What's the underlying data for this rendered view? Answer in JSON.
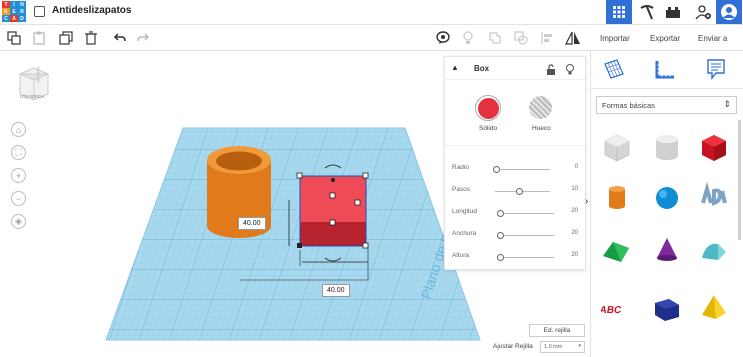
{
  "app": {
    "logo_letters": [
      "T",
      "I",
      "N",
      "K",
      "E",
      "R",
      "C",
      "A",
      "D"
    ],
    "title": "Antideslizapatos"
  },
  "colors": {
    "accent": "#2f6fd6",
    "workplane": "#a7d8ee",
    "box_red": "#e5303d",
    "cylinder_orange": "#e07a1a"
  },
  "header_actions": {
    "grid_view_icon": "grid-icon",
    "tinker_icon": "pickaxe-icon",
    "bricks_icon": "brick-icon",
    "add_user_icon": "add-user-icon",
    "avatar_icon": "avatar"
  },
  "toolbar": {
    "icons": [
      "copy-icon",
      "paste-icon",
      "duplicate-icon",
      "delete-icon",
      "undo-icon",
      "redo-icon"
    ],
    "right_icons": [
      "note-icon",
      "light-icon",
      "group-icon",
      "ungroup-icon",
      "align-icon",
      "mirror-icon"
    ],
    "import_label": "Importar",
    "export_label": "Exportar",
    "send_label": "Enviar a"
  },
  "view_cube": {
    "label": "IZQUIERDA",
    "side_label": "DETRÁS"
  },
  "workplane": {
    "watermark": "Plano de trabajo",
    "dim_height": "40.00",
    "dim_width": "40.00"
  },
  "inspector": {
    "title": "Box",
    "solid_label": "Sólido",
    "hole_label": "Hueco",
    "params": [
      {
        "label": "Radio",
        "value": "0",
        "fraction": 0.0
      },
      {
        "label": "Pasos",
        "value": "10",
        "fraction": 0.45
      },
      {
        "label": "Longitud",
        "value": "20",
        "fraction": 0.0
      },
      {
        "label": "Anchura",
        "value": "20",
        "fraction": 0.0
      },
      {
        "label": "Altura",
        "value": "20",
        "fraction": 0.0
      }
    ]
  },
  "right_panel": {
    "category": "Formas básicas",
    "shapes": [
      "box-striped",
      "cylinder-striped",
      "box-red",
      "cylinder-orange",
      "sphere-blue",
      "text-3d",
      "roof-green",
      "cone-purple",
      "round-roof-teal",
      "text-red",
      "box-navy",
      "pyramid-yellow"
    ]
  },
  "footer": {
    "edit_grid": "Ed. rejilla",
    "snap_label": "Ajustar Rejilla",
    "snap_value": "1.0 mm"
  }
}
